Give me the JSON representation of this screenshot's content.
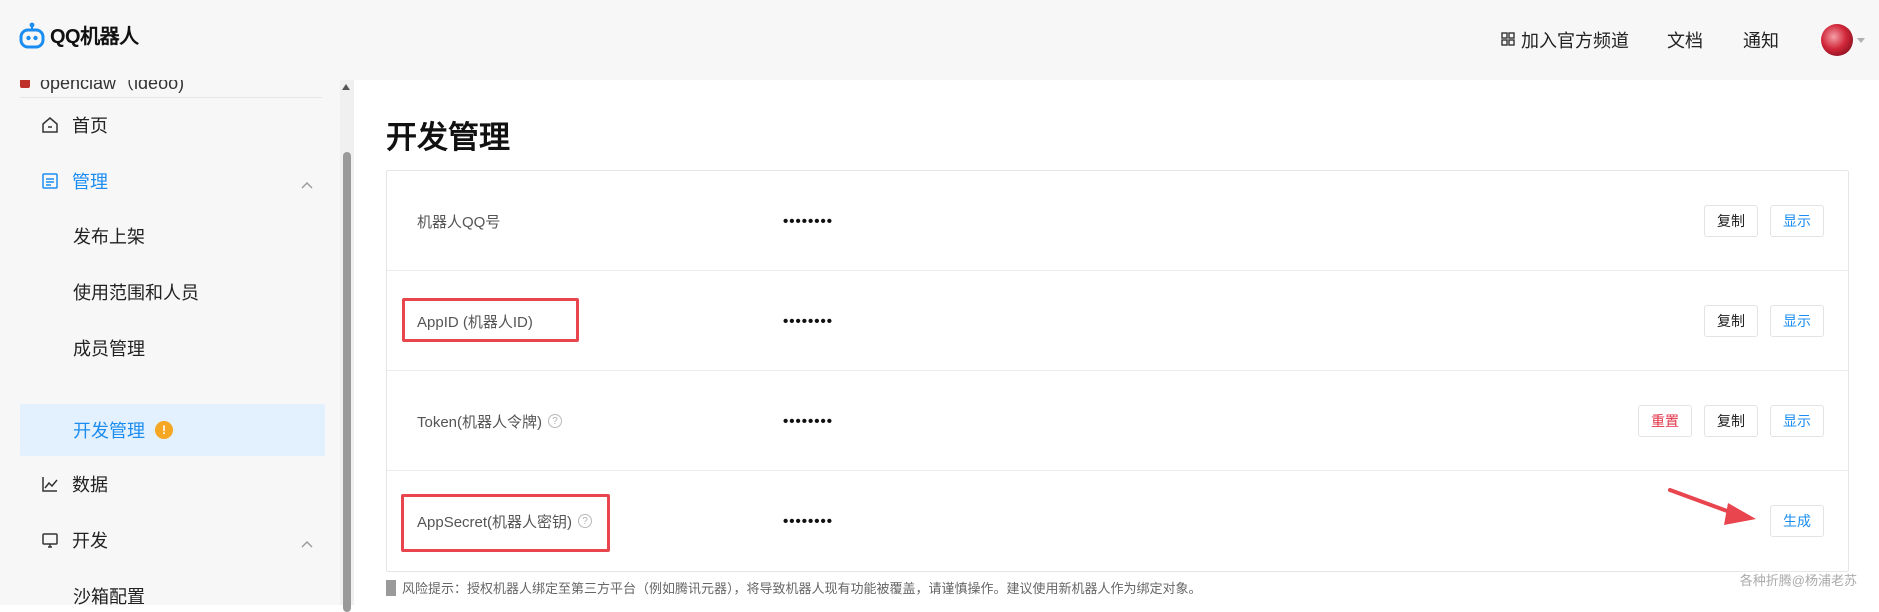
{
  "header": {
    "logo_text": "QQ机器人",
    "nav": {
      "channel": "加入官方频道",
      "docs": "文档",
      "notice": "通知"
    }
  },
  "sidebar": {
    "app_name": "openclaw（ldeoo)",
    "items": [
      {
        "label": "首页",
        "icon": "home-icon"
      },
      {
        "label": "管理",
        "icon": "manage-icon"
      },
      {
        "label": "发布上架"
      },
      {
        "label": "使用范围和人员"
      },
      {
        "label": "成员管理"
      },
      {
        "label": "开发管理",
        "badge": "!"
      },
      {
        "label": "数据",
        "icon": "chart-icon"
      },
      {
        "label": "开发",
        "icon": "monitor-icon"
      },
      {
        "label": "沙箱配置"
      }
    ]
  },
  "main": {
    "title": "开发管理",
    "rows": [
      {
        "label": "机器人QQ号",
        "value": "••••••••",
        "copy": "复制",
        "show": "显示"
      },
      {
        "label": "AppID (机器人ID)",
        "value": "••••••••",
        "copy": "复制",
        "show": "显示"
      },
      {
        "label": "Token(机器人令牌)",
        "value": "••••••••",
        "reset": "重置",
        "copy": "复制",
        "show": "显示"
      },
      {
        "label": "AppSecret(机器人密钥)",
        "value": "••••••••",
        "generate": "生成"
      }
    ],
    "risk_tip": "风险提示：授权机器人绑定至第三方平台（例如腾讯元器），将导致机器人现有功能被覆盖，请谨慎操作。建议使用新机器人作为绑定对象。",
    "watermark": "各种折腾@杨浦老苏"
  },
  "colors": {
    "accent": "#1b8df0",
    "danger": "#e0354a",
    "highlight": "#e8454f",
    "badge": "#f5a623"
  }
}
